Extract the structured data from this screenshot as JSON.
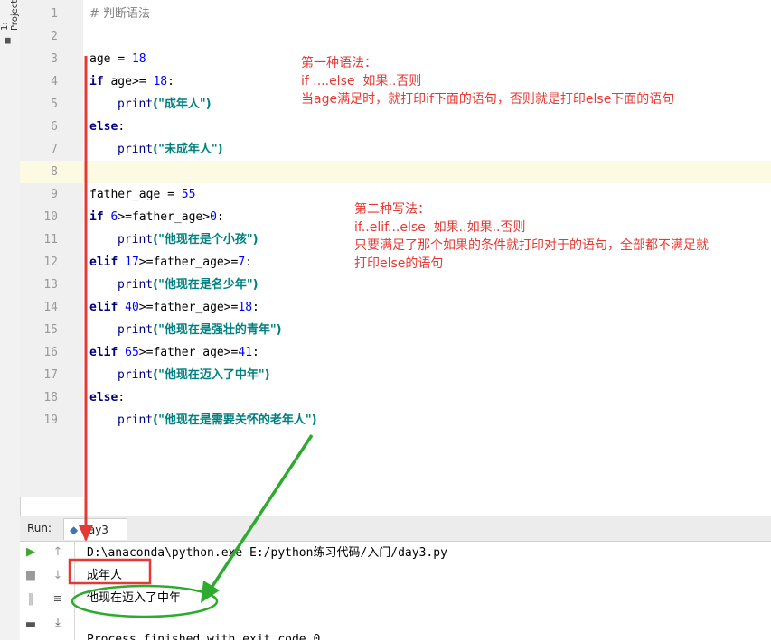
{
  "sidebar": {
    "project_tab": "1: Project",
    "folder_icon": "folder-icon"
  },
  "editor": {
    "lines": [
      {
        "n": "1"
      },
      {
        "n": "2"
      },
      {
        "n": "3"
      },
      {
        "n": "4"
      },
      {
        "n": "5"
      },
      {
        "n": "6"
      },
      {
        "n": "7"
      },
      {
        "n": "8"
      },
      {
        "n": "9"
      },
      {
        "n": "10"
      },
      {
        "n": "11"
      },
      {
        "n": "12"
      },
      {
        "n": "13"
      },
      {
        "n": "14"
      },
      {
        "n": "15"
      },
      {
        "n": "16"
      },
      {
        "n": "17"
      },
      {
        "n": "18"
      },
      {
        "n": "19"
      }
    ],
    "code": {
      "l1": "# 判断语法",
      "l3_a": "age",
      "l3_b": " = ",
      "l3_c": "18",
      "l4_kw": "if",
      "l4_a": " age>= ",
      "l4_num": "18",
      "l4_b": ":",
      "l5_fn": "print",
      "l5_s": "(\"成年人\")",
      "l6_kw": "else",
      "l6_b": ":",
      "l7_fn": "print",
      "l7_s": "(\"未成年人\")",
      "l9_a": "father_age = ",
      "l9_num": "55",
      "l10_kw": "if",
      "l10_num": " 6",
      "l10_a": ">=father_age>",
      "l10_num2": "0",
      "l10_b": ":",
      "l11_fn": "print",
      "l11_s": "(\"他现在是个小孩\")",
      "l12_kw": "elif",
      "l12_num": " 17",
      "l12_a": ">=father_age>=",
      "l12_num2": "7",
      "l12_b": ":",
      "l13_fn": "print",
      "l13_s": "(\"他现在是名少年\")",
      "l14_kw": "elif",
      "l14_num": " 40",
      "l14_a": ">=father_age>=",
      "l14_num2": "18",
      "l14_b": ":",
      "l15_fn": "print",
      "l15_s": "(\"他现在是强壮的青年\")",
      "l16_kw": "elif",
      "l16_num": " 65",
      "l16_a": ">=father_age>=",
      "l16_num2": "41",
      "l16_b": ":",
      "l17_fn": "print",
      "l17_s": "(\"他现在迈入了中年\")",
      "l18_kw": "else",
      "l18_b": ":",
      "l19_fn": "print",
      "l19_s": "(\"他现在是需要关怀的老年人\")"
    }
  },
  "notes": {
    "first": "第一种语法：\nif ....else  如果..否则\n当age满足时，就打印if下面的语句，否则就是打印else下面的语句",
    "second": "第二种写法：\nif..elif...else  如果..如果..否则\n只要满足了那个如果的条件就打印对于的语句，全部都不满足就\n打印else的语句"
  },
  "run": {
    "label": "Run:",
    "tab": "day3",
    "cmd": "D:\\anaconda\\python.exe E:/python练习代码/入门/day3.py",
    "out1": "成年人",
    "out2": "他现在迈入了中年",
    "out3": "Process finished with exit code 0"
  },
  "colors": {
    "annotation_red": "#e53935",
    "annotation_green": "#2eab2e",
    "keyword": "#000080",
    "string": "#008080"
  }
}
